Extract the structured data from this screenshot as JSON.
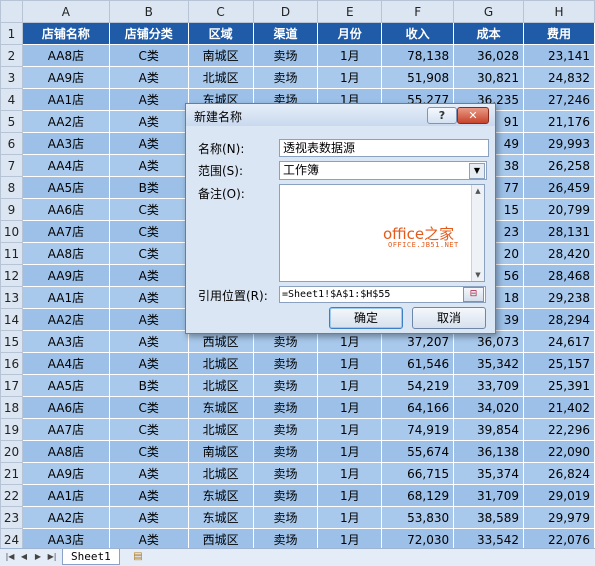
{
  "columns": [
    "A",
    "B",
    "C",
    "D",
    "E",
    "F",
    "G",
    "H"
  ],
  "header_row": [
    "店铺名称",
    "店铺分类",
    "区域",
    "渠道",
    "月份",
    "收入",
    "成本",
    "费用"
  ],
  "rows": [
    {
      "num": "2",
      "cells": [
        "AA8店",
        "C类",
        "南城区",
        "卖场",
        "1月",
        "78,138",
        "36,028",
        "23,141"
      ]
    },
    {
      "num": "3",
      "cells": [
        "AA9店",
        "A类",
        "北城区",
        "卖场",
        "1月",
        "51,908",
        "30,821",
        "24,832"
      ]
    },
    {
      "num": "4",
      "cells": [
        "AA1店",
        "A类",
        "东城区",
        "卖场",
        "1月",
        "55,277",
        "36,235",
        "27,246"
      ]
    },
    {
      "num": "5",
      "cells": [
        "AA2店",
        "A类",
        "",
        "",
        "",
        "",
        "91",
        "21,176"
      ]
    },
    {
      "num": "6",
      "cells": [
        "AA3店",
        "A类",
        "",
        "",
        "",
        "",
        "49",
        "29,993"
      ]
    },
    {
      "num": "7",
      "cells": [
        "AA4店",
        "A类",
        "",
        "",
        "",
        "",
        "38",
        "26,258"
      ]
    },
    {
      "num": "8",
      "cells": [
        "AA5店",
        "B类",
        "",
        "",
        "",
        "",
        "77",
        "26,459"
      ]
    },
    {
      "num": "9",
      "cells": [
        "AA6店",
        "C类",
        "",
        "",
        "",
        "",
        "15",
        "20,799"
      ]
    },
    {
      "num": "10",
      "cells": [
        "AA7店",
        "C类",
        "",
        "",
        "",
        "",
        "23",
        "28,131"
      ]
    },
    {
      "num": "11",
      "cells": [
        "AA8店",
        "C类",
        "",
        "",
        "",
        "",
        "20",
        "28,420"
      ]
    },
    {
      "num": "12",
      "cells": [
        "AA9店",
        "A类",
        "",
        "",
        "",
        "",
        "56",
        "28,468"
      ]
    },
    {
      "num": "13",
      "cells": [
        "AA1店",
        "A类",
        "",
        "",
        "",
        "",
        "18",
        "29,238"
      ]
    },
    {
      "num": "14",
      "cells": [
        "AA2店",
        "A类",
        "",
        "",
        "",
        "",
        "39",
        "28,294"
      ]
    },
    {
      "num": "15",
      "cells": [
        "AA3店",
        "A类",
        "西城区",
        "卖场",
        "1月",
        "37,207",
        "36,073",
        "24,617"
      ]
    },
    {
      "num": "16",
      "cells": [
        "AA4店",
        "A类",
        "北城区",
        "卖场",
        "1月",
        "61,546",
        "35,342",
        "25,157"
      ]
    },
    {
      "num": "17",
      "cells": [
        "AA5店",
        "B类",
        "北城区",
        "卖场",
        "1月",
        "54,219",
        "33,709",
        "25,391"
      ]
    },
    {
      "num": "18",
      "cells": [
        "AA6店",
        "C类",
        "东城区",
        "卖场",
        "1月",
        "64,166",
        "34,020",
        "21,402"
      ]
    },
    {
      "num": "19",
      "cells": [
        "AA7店",
        "C类",
        "北城区",
        "卖场",
        "1月",
        "74,919",
        "39,854",
        "22,296"
      ]
    },
    {
      "num": "20",
      "cells": [
        "AA8店",
        "C类",
        "南城区",
        "卖场",
        "1月",
        "55,674",
        "36,138",
        "22,090"
      ]
    },
    {
      "num": "21",
      "cells": [
        "AA9店",
        "A类",
        "北城区",
        "卖场",
        "1月",
        "66,715",
        "35,374",
        "26,824"
      ]
    },
    {
      "num": "22",
      "cells": [
        "AA1店",
        "A类",
        "东城区",
        "卖场",
        "1月",
        "68,129",
        "31,709",
        "29,019"
      ]
    },
    {
      "num": "23",
      "cells": [
        "AA2店",
        "A类",
        "东城区",
        "卖场",
        "1月",
        "53,830",
        "38,589",
        "29,979"
      ]
    },
    {
      "num": "24",
      "cells": [
        "AA3店",
        "A类",
        "西城区",
        "卖场",
        "1月",
        "72,030",
        "33,542",
        "22,076"
      ]
    }
  ],
  "sheet_tab": "Sheet1",
  "dialog": {
    "title": "新建名称",
    "help_label": "?",
    "close_label": "✕",
    "name_label": "名称(N):",
    "name_value": "透视表数据源",
    "scope_label": "范围(S):",
    "scope_value": "工作簿",
    "comment_label": "备注(O):",
    "ref_label": "引用位置(R):",
    "ref_value": "=Sheet1!$A$1:$H$55",
    "ok_label": "确定",
    "cancel_label": "取消",
    "watermark_main": "office之家",
    "watermark_sub": "OFFICE.JB51.NET"
  },
  "accent_colors": {
    "header_fill": "#1f5ba7",
    "cell_fill": "#9cc0e8",
    "close_button": "#c7432a"
  }
}
